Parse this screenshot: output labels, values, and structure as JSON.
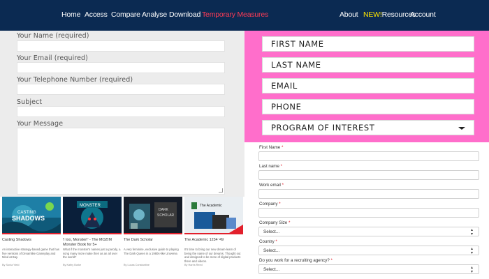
{
  "nav": {
    "left": [
      "Home",
      "Access",
      "Compare",
      "Analyse",
      "Download",
      "Temporary Measures"
    ],
    "right": {
      "about": "About",
      "new": "NEW!",
      "resources": "Resources",
      "account": "Account"
    },
    "active_color": "#ff3b55",
    "bg_color": "#0b2a52"
  },
  "contact_form": {
    "name_label": "Your Name (required)",
    "email_label": "Your Email (required)",
    "phone_label": "Your Telephone Number (required)",
    "subject_label": "Subject",
    "message_label": "Your Message"
  },
  "cards": [
    {
      "title": "Casting Shadows",
      "excerpt": "An interactive strategy-based game that has five versions of Dreamlike Gameplay and Mind at Bay.",
      "byline": "By Sonia Yield",
      "icon": "game-art-image"
    },
    {
      "title": "'I too, Monster!' - The MOZIM Monster Book for 5+",
      "excerpt": "What if the monster's names just a parody, a song many more make their as an all over the world?",
      "byline": "By Kathy Burke",
      "icon": "monster-book-image"
    },
    {
      "title": "The Dark Scholar",
      "excerpt": "A very feminine, exclusive guide to playing The Dark Queen in a 1980s-like Universe.",
      "byline": "By Lucas Constantine",
      "icon": "board-game-image"
    },
    {
      "title": "The Academic 1234 '49",
      "excerpt": "It's time to bring our new dream-learn of being the name of our dreams. Thought out and designed to be more of digital products there and videos.",
      "byline": "By Harris Reed",
      "icon": "academic-box-image"
    }
  ],
  "pink_form": {
    "first_name": "FIRST NAME",
    "last_name": "LAST NAME",
    "email": "EMAIL",
    "phone": "PHONE",
    "program": "PROGRAM OF INTEREST",
    "bg_color": "#ff6ecb"
  },
  "lower_form": {
    "first_name": "First Name",
    "last_name": "Last name",
    "work_email": "Work email",
    "company": "Company",
    "company_size": "Company Size",
    "company_size_value": "Select...",
    "country": "Country",
    "country_value": "Select...",
    "agency_question": "Do you work for a recruiting agency?",
    "agency_value": "Select...",
    "required_mark": "*"
  }
}
